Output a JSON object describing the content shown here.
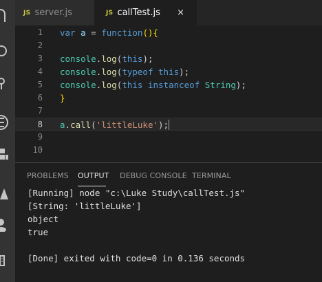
{
  "activity_bar": {
    "icons": [
      "explorer-icon",
      "search-icon",
      "source-control-icon",
      "debug-icon",
      "extensions-icon",
      "warning-icon",
      "account-icon",
      "bottom-icon"
    ]
  },
  "tabs": [
    {
      "badge": "JS",
      "label": "server.js",
      "active": false
    },
    {
      "badge": "JS",
      "label": "callTest.js",
      "active": true,
      "close": "×"
    }
  ],
  "editor": {
    "line_numbers": [
      "1",
      "2",
      "3",
      "4",
      "5",
      "6",
      "7",
      "8",
      "9",
      "10"
    ],
    "current_line": "8",
    "code": {
      "l1": {
        "kw": "var",
        "name": "a",
        "eq": " = ",
        "fn": "function",
        "paren": "()",
        "brace": "{"
      },
      "l3": {
        "obj": "console",
        "dot": ".",
        "method": "log",
        "open": "(",
        "arg": "this",
        "close": ");"
      },
      "l4": {
        "obj": "console",
        "dot": ".",
        "method": "log",
        "open": "(",
        "kw": "typeof",
        "sp": " ",
        "arg": "this",
        "close": ");"
      },
      "l5": {
        "obj": "console",
        "dot": ".",
        "method": "log",
        "open": "(",
        "arg": "this",
        "sp1": " ",
        "kw": "instanceof",
        "sp2": " ",
        "type": "String",
        "close": ");"
      },
      "l6": {
        "brace": "}"
      },
      "l8": {
        "obj": "a",
        "dot": ".",
        "method": "call",
        "open": "(",
        "str": "'littleLuke'",
        "close": ");"
      }
    }
  },
  "panel": {
    "tabs": [
      "PROBLEMS",
      "OUTPUT",
      "DEBUG CONSOLE",
      "TERMINAL"
    ],
    "active_tab": "OUTPUT",
    "output": [
      "[Running] node \"c:\\Luke Study\\callTest.js\"",
      "[String: 'littleLuke']",
      "object",
      "true",
      "",
      "[Done] exited with code=0 in 0.136 seconds"
    ]
  }
}
